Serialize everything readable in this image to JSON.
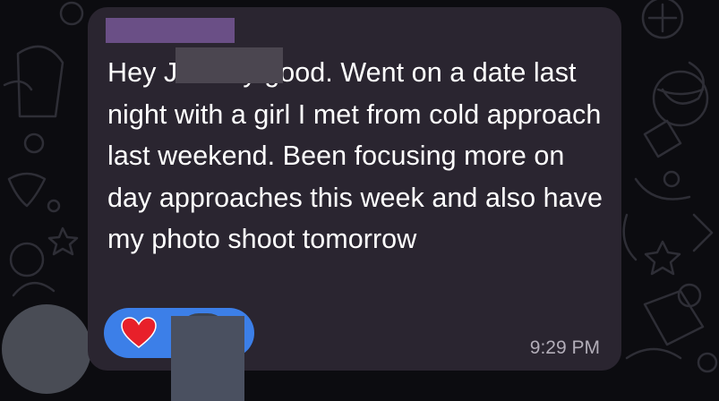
{
  "message": {
    "text": "Hey J        Pretty good. Went on a date last night with a girl I met from cold approach last weekend. Been focusing more on day approaches this week and also have my photo shoot tomorrow",
    "timestamp": "9:29 PM"
  },
  "reactions": {
    "emoji_icon": "heart-icon",
    "heart_color": "#e8202a"
  },
  "colors": {
    "bubble": "#2a2530",
    "reaction_pill": "#3c7fe8",
    "timestamp": "#b2adb8"
  }
}
